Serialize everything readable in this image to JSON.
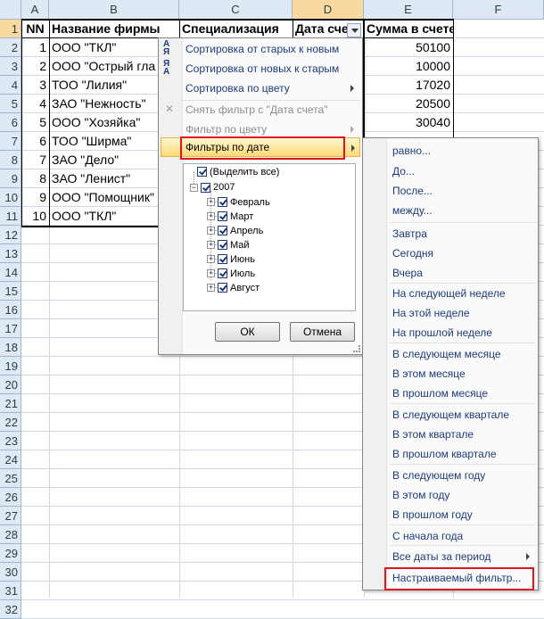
{
  "columns": [
    "A",
    "B",
    "C",
    "D",
    "E",
    "F"
  ],
  "rows": [
    "1",
    "2",
    "3",
    "4",
    "5",
    "6",
    "7",
    "8",
    "9",
    "10",
    "11",
    "12",
    "13",
    "14",
    "15",
    "16",
    "17",
    "18",
    "19",
    "20",
    "21",
    "22",
    "23",
    "24",
    "25",
    "26",
    "27",
    "28",
    "29",
    "30",
    "31",
    "32"
  ],
  "table": {
    "headers": {
      "nn": "NN",
      "firm": "Название фирмы",
      "spec": "Специализация",
      "date": "Дата счета",
      "sum": "Сумма в счете"
    },
    "records": [
      {
        "nn": "1",
        "firm": "ООО \"ТКЛ\"",
        "sum": "50100"
      },
      {
        "nn": "2",
        "firm": "ООО \"Острый гла",
        "sum": "10000"
      },
      {
        "nn": "3",
        "firm": "ТОО \"Лилия\"",
        "sum": "17020"
      },
      {
        "nn": "4",
        "firm": "ЗАО \"Нежность\"",
        "sum": "20500"
      },
      {
        "nn": "5",
        "firm": "ООО \"Хозяйка\"",
        "sum": "30040"
      },
      {
        "nn": "6",
        "firm": "ТОО \"Ширма\"",
        "sum": ""
      },
      {
        "nn": "7",
        "firm": "ЗАО \"Дело\"",
        "sum": ""
      },
      {
        "nn": "8",
        "firm": "ЗАО \"Ленист\"",
        "sum": ""
      },
      {
        "nn": "9",
        "firm": "ООО \"Помощник\"",
        "sum": ""
      },
      {
        "nn": "10",
        "firm": "ООО \"ТКЛ\"",
        "sum": ""
      }
    ]
  },
  "filter_menu": {
    "sort_old_new": "Сортировка от старых к новым",
    "sort_new_old": "Сортировка от новых к старым",
    "sort_color": "Сортировка по цвету",
    "clear_filter": "Снять фильтр с \"Дата счета\"",
    "filter_color": "Фильтр по цвету",
    "date_filters": "Фильтры по дате",
    "tree": {
      "select_all": "(Выделить все)",
      "year": "2007",
      "months": [
        "Февраль",
        "Март",
        "Апрель",
        "Май",
        "Июнь",
        "Июль",
        "Август"
      ]
    },
    "ok": "ОК",
    "cancel": "Отмена"
  },
  "date_submenu": {
    "items": [
      "равно...",
      "До...",
      "После...",
      "между...",
      "Завтра",
      "Сегодня",
      "Вчера",
      "На следующей неделе",
      "На этой неделе",
      "На прошлой неделе",
      "В следующем месяце",
      "В этом месяце",
      "В прошлом месяце",
      "В следующем квартале",
      "В этом квартале",
      "В прошлом квартале",
      "В следующем году",
      "В этом году",
      "В прошлом году",
      "С начала года",
      "Все даты за период",
      "Настраиваемый фильтр..."
    ]
  },
  "colors": {
    "highlight_border": "#e0141a",
    "menu_text": "#1c3b7a",
    "header_bg": "#dfe8f5",
    "active_header": "#f9d99f"
  }
}
